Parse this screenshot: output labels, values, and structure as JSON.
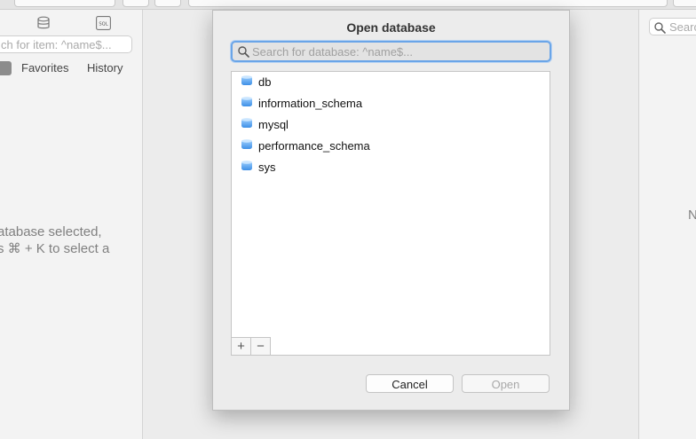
{
  "sidebar": {
    "search_placeholder": "ch for item: ^name$...",
    "tabs": [
      "Favorites",
      "History"
    ],
    "message_line1": "atabase selected,",
    "message_line2": "s ⌘ + K to select a",
    "icons": [
      "database-icon",
      "sql-icon"
    ]
  },
  "right_panel": {
    "search_placeholder": "Search",
    "message_fragment": "N"
  },
  "dialog": {
    "title": "Open database",
    "search_placeholder": "Search for database: ^name$...",
    "search_value": "",
    "databases": [
      "db",
      "information_schema",
      "mysql",
      "performance_schema",
      "sys"
    ],
    "add_label": "+",
    "remove_label": "−",
    "cancel_label": "Cancel",
    "open_label": "Open"
  },
  "colors": {
    "focus_ring": "#6aa5e8",
    "db_icon": "#5aa5f0"
  }
}
